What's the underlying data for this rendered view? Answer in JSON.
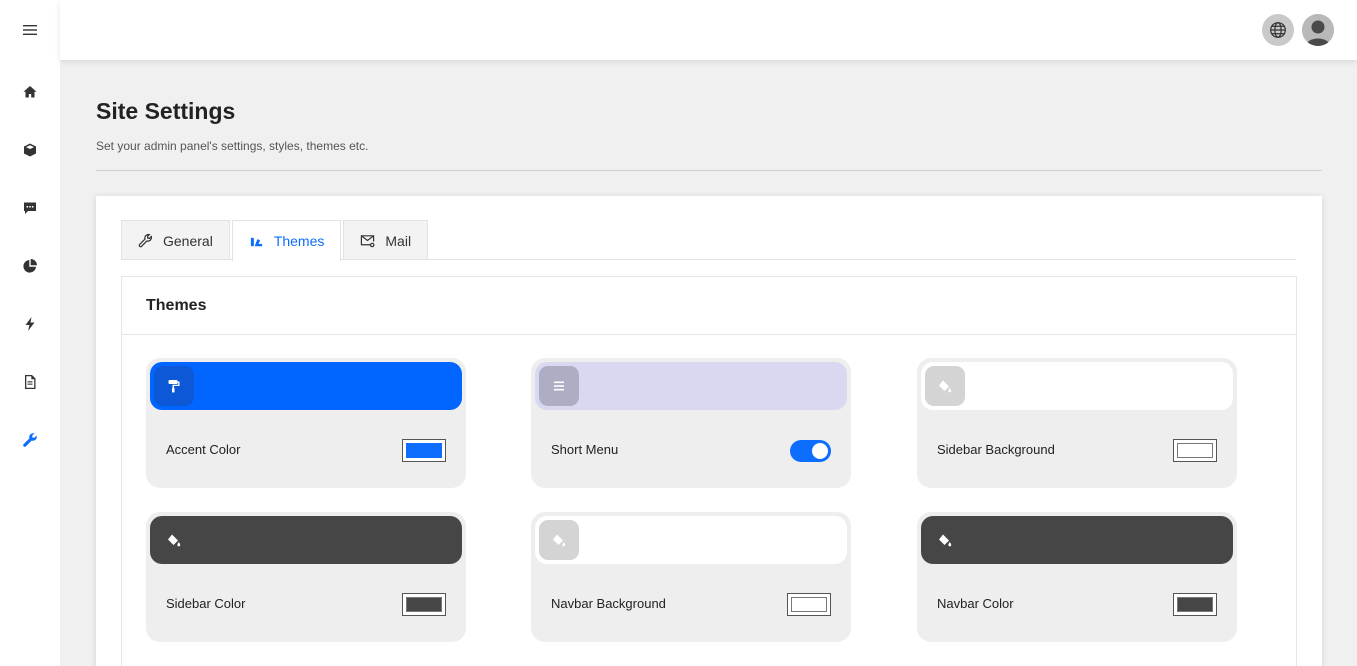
{
  "sidebar": {
    "items": [
      {
        "name": "menu",
        "icon": "hamburger-icon",
        "active": false
      },
      {
        "name": "home",
        "icon": "home-icon",
        "active": false
      },
      {
        "name": "products",
        "icon": "box-icon",
        "active": false
      },
      {
        "name": "messages",
        "icon": "chat-icon",
        "active": false
      },
      {
        "name": "reports",
        "icon": "pie-chart-icon",
        "active": false
      },
      {
        "name": "actions",
        "icon": "lightning-icon",
        "active": false
      },
      {
        "name": "documents",
        "icon": "document-icon",
        "active": false
      },
      {
        "name": "settings",
        "icon": "wrench-icon",
        "active": true
      }
    ]
  },
  "topbar": {
    "language_icon": "globe-icon",
    "avatar_icon": "user-avatar-icon"
  },
  "page": {
    "title": "Site Settings",
    "subtitle": "Set your admin panel's settings, styles, themes etc."
  },
  "tabs": [
    {
      "label": "General",
      "icon": "wrench-icon",
      "active": false
    },
    {
      "label": "Themes",
      "icon": "palette-icon",
      "active": true
    },
    {
      "label": "Mail",
      "icon": "mail-settings-icon",
      "active": false
    }
  ],
  "themes": {
    "title": "Themes",
    "items": [
      {
        "label": "Accent Color",
        "control": "color",
        "value": "#0d6efd",
        "banner": "#0066ff",
        "icon": "paint-roller-icon",
        "icon_bg": "#0d58d6"
      },
      {
        "label": "Short Menu",
        "control": "toggle",
        "value": true,
        "banner": "#d8d8f0",
        "icon": "list-icon",
        "icon_bg": "#adadc4"
      },
      {
        "label": "Sidebar Background",
        "control": "color",
        "value": "#ffffff",
        "banner": "#ffffff",
        "icon": "paint-bucket-icon",
        "icon_bg": "#d4d4d4"
      },
      {
        "label": "Sidebar Color",
        "control": "color",
        "value": "#464646",
        "banner": "#464646",
        "icon": "paint-bucket-icon",
        "icon_bg": "#464646"
      },
      {
        "label": "Navbar Background",
        "control": "color",
        "value": "#ffffff",
        "banner": "#ffffff",
        "icon": "paint-bucket-icon",
        "icon_bg": "#d4d4d4"
      },
      {
        "label": "Navbar Color",
        "control": "color",
        "value": "#464646",
        "banner": "#464646",
        "icon": "paint-bucket-icon",
        "icon_bg": "#464646"
      }
    ]
  },
  "colors": {
    "accent": "#0d6efd",
    "page_bg": "#f0f0f0"
  }
}
